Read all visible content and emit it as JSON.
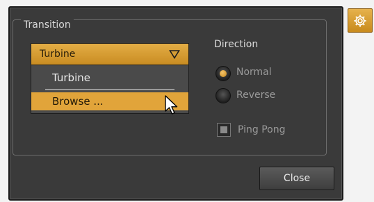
{
  "dialog": {
    "group_title": "Transition",
    "transition_dropdown": {
      "selected": "Turbine",
      "options": [
        "Turbine",
        "Browse ..."
      ],
      "highlighted": "Browse ..."
    },
    "direction": {
      "label": "Direction",
      "options": [
        {
          "label": "Normal",
          "selected": true
        },
        {
          "label": "Reverse",
          "selected": false
        }
      ]
    },
    "ping_pong": {
      "label": "Ping Pong",
      "checked": false
    },
    "close_label": "Close"
  },
  "icons": {
    "settings": "gear-icon",
    "dropdown": "triangle-down-icon",
    "cursor": "mouse-pointer-icon"
  },
  "colors": {
    "accent": "#e1a43a",
    "panel": "#3a3a3a",
    "text": "#dcdcdc",
    "disabled_text": "#9a9a9a"
  }
}
